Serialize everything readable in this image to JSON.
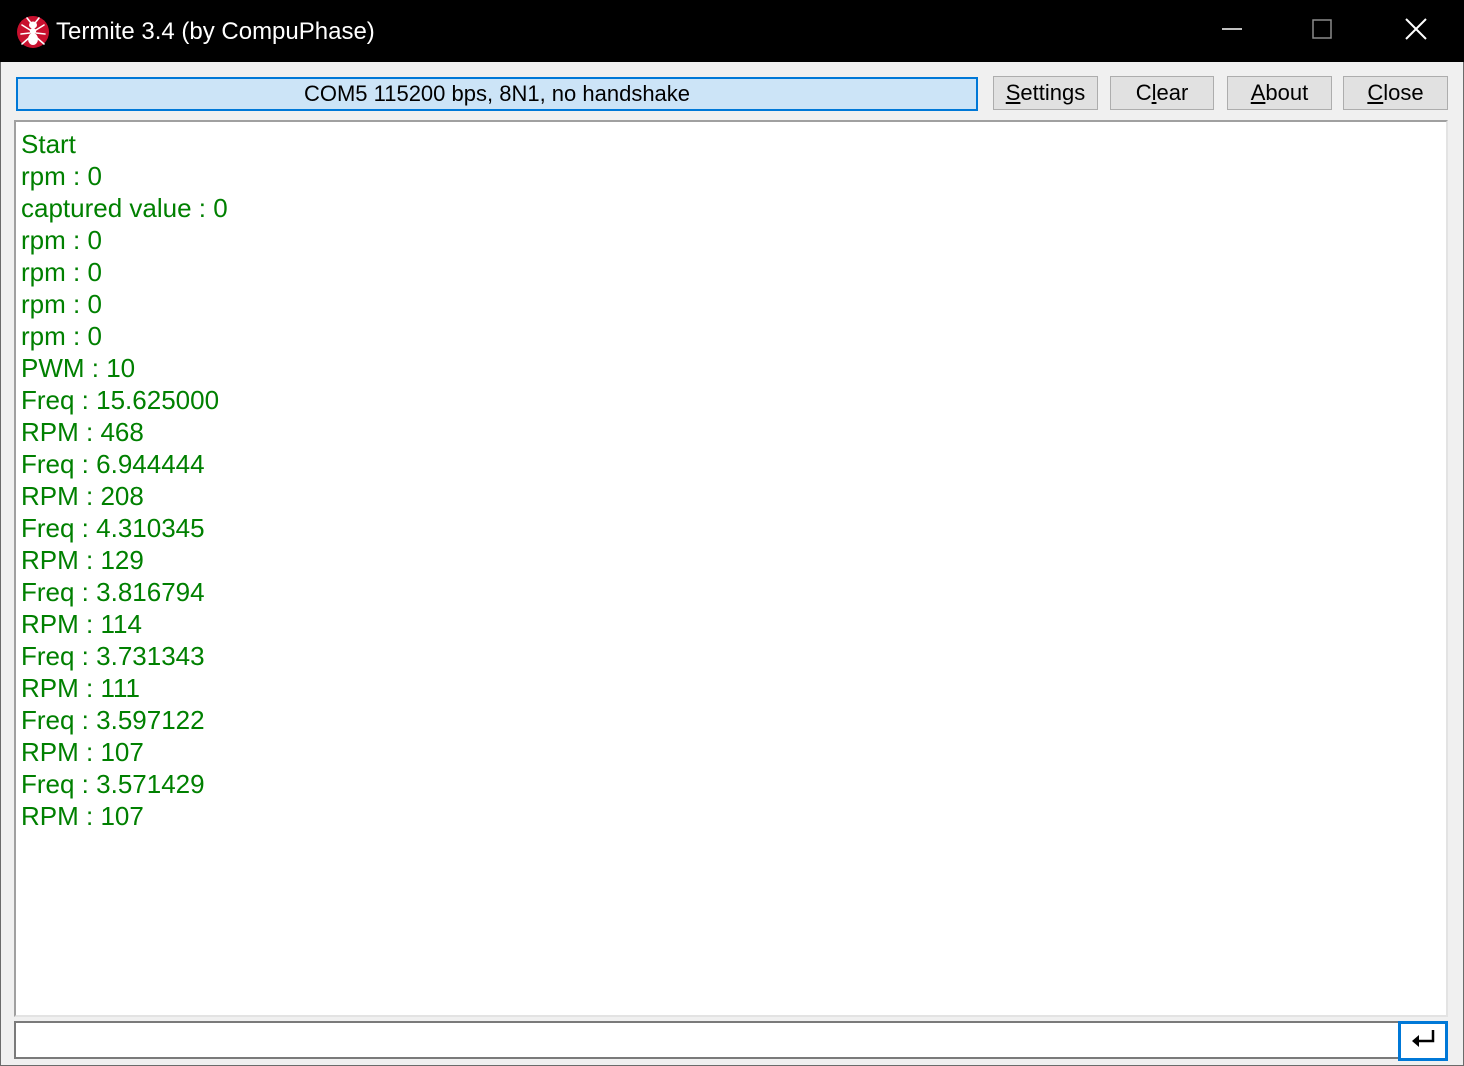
{
  "window": {
    "title": "Termite 3.4 (by CompuPhase)",
    "icon": "ant-icon",
    "controls": [
      "minimize-icon",
      "maximize-icon",
      "close-icon"
    ]
  },
  "toolbar": {
    "status": "COM5 115200 bps, 8N1, no handshake",
    "settings": {
      "accel": "S",
      "rest": "ettings"
    },
    "clear": {
      "pre": "C",
      "accel": "l",
      "rest": "ear"
    },
    "about": {
      "accel": "A",
      "rest": "bout"
    },
    "close": {
      "accel": "C",
      "rest": "lose"
    }
  },
  "output": {
    "text_color": "#008000",
    "lines": [
      "Start",
      "rpm : 0",
      "captured value : 0",
      "rpm : 0",
      "rpm : 0",
      "rpm : 0",
      "rpm : 0",
      "PWM : 10",
      "Freq : 15.625000",
      "RPM : 468",
      "Freq : 6.944444",
      "RPM : 208",
      "Freq : 4.310345",
      "RPM : 129",
      "Freq : 3.816794",
      "RPM : 114",
      "Freq : 3.731343",
      "RPM : 111",
      "Freq : 3.597122",
      "RPM : 107",
      "Freq : 3.571429",
      "RPM : 107"
    ]
  },
  "input": {
    "value": "",
    "send_icon": "enter-icon"
  },
  "colors": {
    "accent": "#0078d7",
    "status_bg": "#cce4f7",
    "titlebar_bg": "#000000"
  }
}
